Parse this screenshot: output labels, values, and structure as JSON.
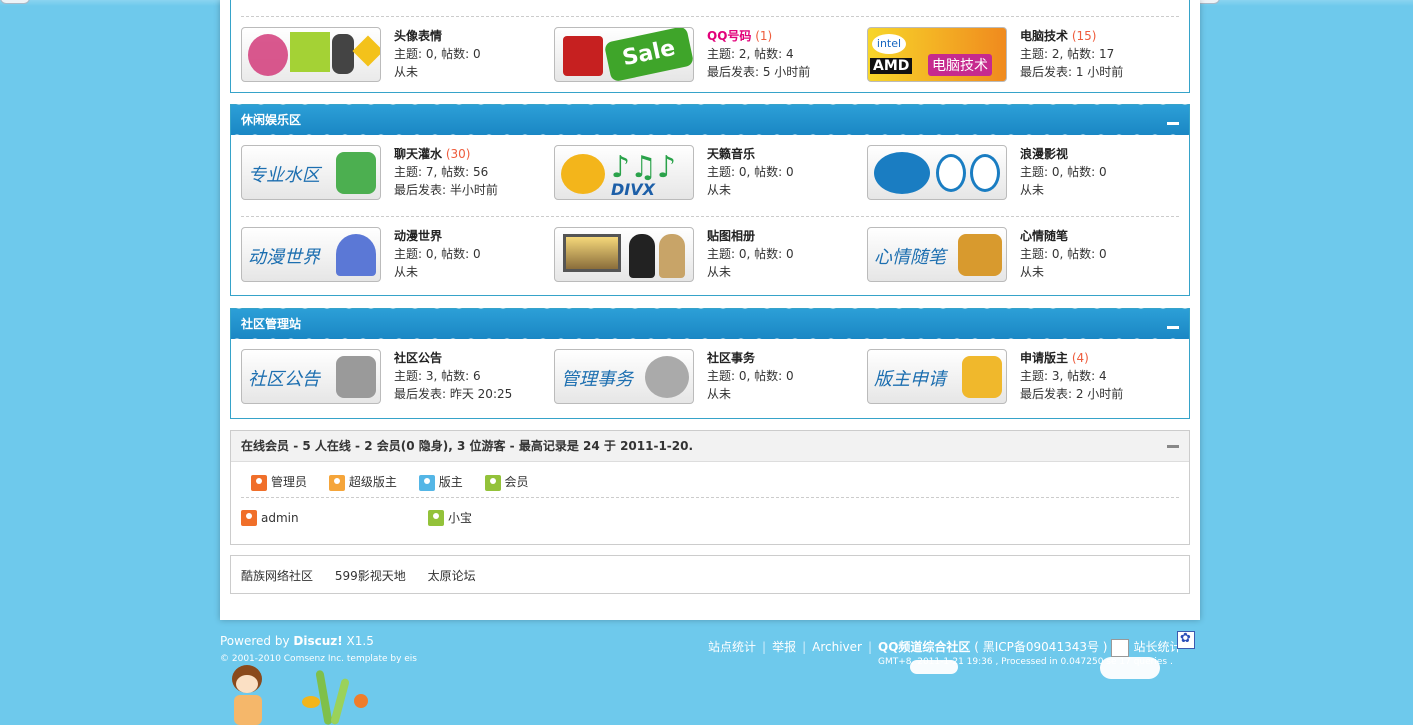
{
  "groups": [
    {
      "title": "",
      "forums": [
        {
          "name": "头像表情",
          "today": "",
          "stats": "主题: 0, 帖数: 0",
          "last": "从未",
          "thumb_text": "",
          "accent": "#d23b7a"
        },
        {
          "name": "QQ号码",
          "today": "(1)",
          "stats": "主题: 2, 帖数: 4",
          "last": "最后发表: 5 小时前",
          "thumb_text": "Sale",
          "accent": "#3fa52a"
        },
        {
          "name": "电脑技术",
          "today": "(15)",
          "stats": "主题: 2, 帖数: 17",
          "last": "最后发表: 1 小时前",
          "thumb_text": "电脑技术",
          "accent": "#f08a1e"
        }
      ]
    },
    {
      "title": "休闲娱乐区",
      "forums": [
        {
          "name": "聊天灌水",
          "today": "(30)",
          "stats": "主题: 7, 帖数: 56",
          "last": "最后发表: 半小时前",
          "thumb_text": "专业水区",
          "accent": "#4caf50"
        },
        {
          "name": "天籁音乐",
          "today": "",
          "stats": "主题: 0, 帖数: 0",
          "last": "从未",
          "thumb_text": "DIVX",
          "accent": "#f3b51b"
        },
        {
          "name": "浪漫影视",
          "today": "",
          "stats": "主题: 0, 帖数: 0",
          "last": "从未",
          "thumb_text": "",
          "accent": "#1a7dc2"
        },
        {
          "name": "动漫世界",
          "today": "",
          "stats": "主题: 0, 帖数: 0",
          "last": "从未",
          "thumb_text": "动漫世界",
          "accent": "#5b78d6"
        },
        {
          "name": "贴图相册",
          "today": "",
          "stats": "主题: 0, 帖数: 0",
          "last": "从未",
          "thumb_text": "",
          "accent": "#8a6d3b"
        },
        {
          "name": "心情随笔",
          "today": "",
          "stats": "主题: 0, 帖数: 0",
          "last": "从未",
          "thumb_text": "心情随笔",
          "accent": "#d89a2e"
        }
      ]
    },
    {
      "title": "社区管理站",
      "forums": [
        {
          "name": "社区公告",
          "today": "",
          "stats": "主题: 3, 帖数: 6",
          "last": "最后发表: 昨天 20:25",
          "thumb_text": "社区公告",
          "accent": "#9a9a9a"
        },
        {
          "name": "社区事务",
          "today": "",
          "stats": "主题: 0, 帖数: 0",
          "last": "从未",
          "thumb_text": "管理事务",
          "accent": "#aaaaaa"
        },
        {
          "name": "申请版主",
          "today": "(4)",
          "stats": "主题: 3, 帖数: 4",
          "last": "最后发表: 2 小时前",
          "thumb_text": "版主申请",
          "accent": "#f0b82c"
        }
      ]
    }
  ],
  "online": {
    "label": "在线会员",
    "summary": " - 5 人在线 - 2 会员(0 隐身), 3 位游客 - 最高记录是 24 于 2011-1-20.",
    "legend": [
      "管理员",
      "超级版主",
      "版主",
      "会员"
    ],
    "users": [
      "admin",
      "小宝"
    ]
  },
  "links": [
    "酷族网络社区",
    "599影视天地",
    "太原论坛"
  ],
  "footer": {
    "powered_prefix": "Powered by ",
    "powered_brand": "Discuz!",
    "powered_version": " X1.5",
    "copyright": "© 2001-2010 Comsenz Inc.  template by eis",
    "nav": [
      "站点统计",
      "举报",
      "Archiver"
    ],
    "site_name": "QQ频道综合社区",
    "icp": "( 黑ICP备09041343号 )",
    "stat_label": "站长统计",
    "gmt": "GMT+8, 2011-1-21 19:36 , Processed in 0.047250 se      17 queries ."
  },
  "colors": {
    "background": "#6ec9ec",
    "header_blue": "#1a87c4",
    "today_count": "#ee5c3c",
    "qq_link": "#e2007a"
  }
}
